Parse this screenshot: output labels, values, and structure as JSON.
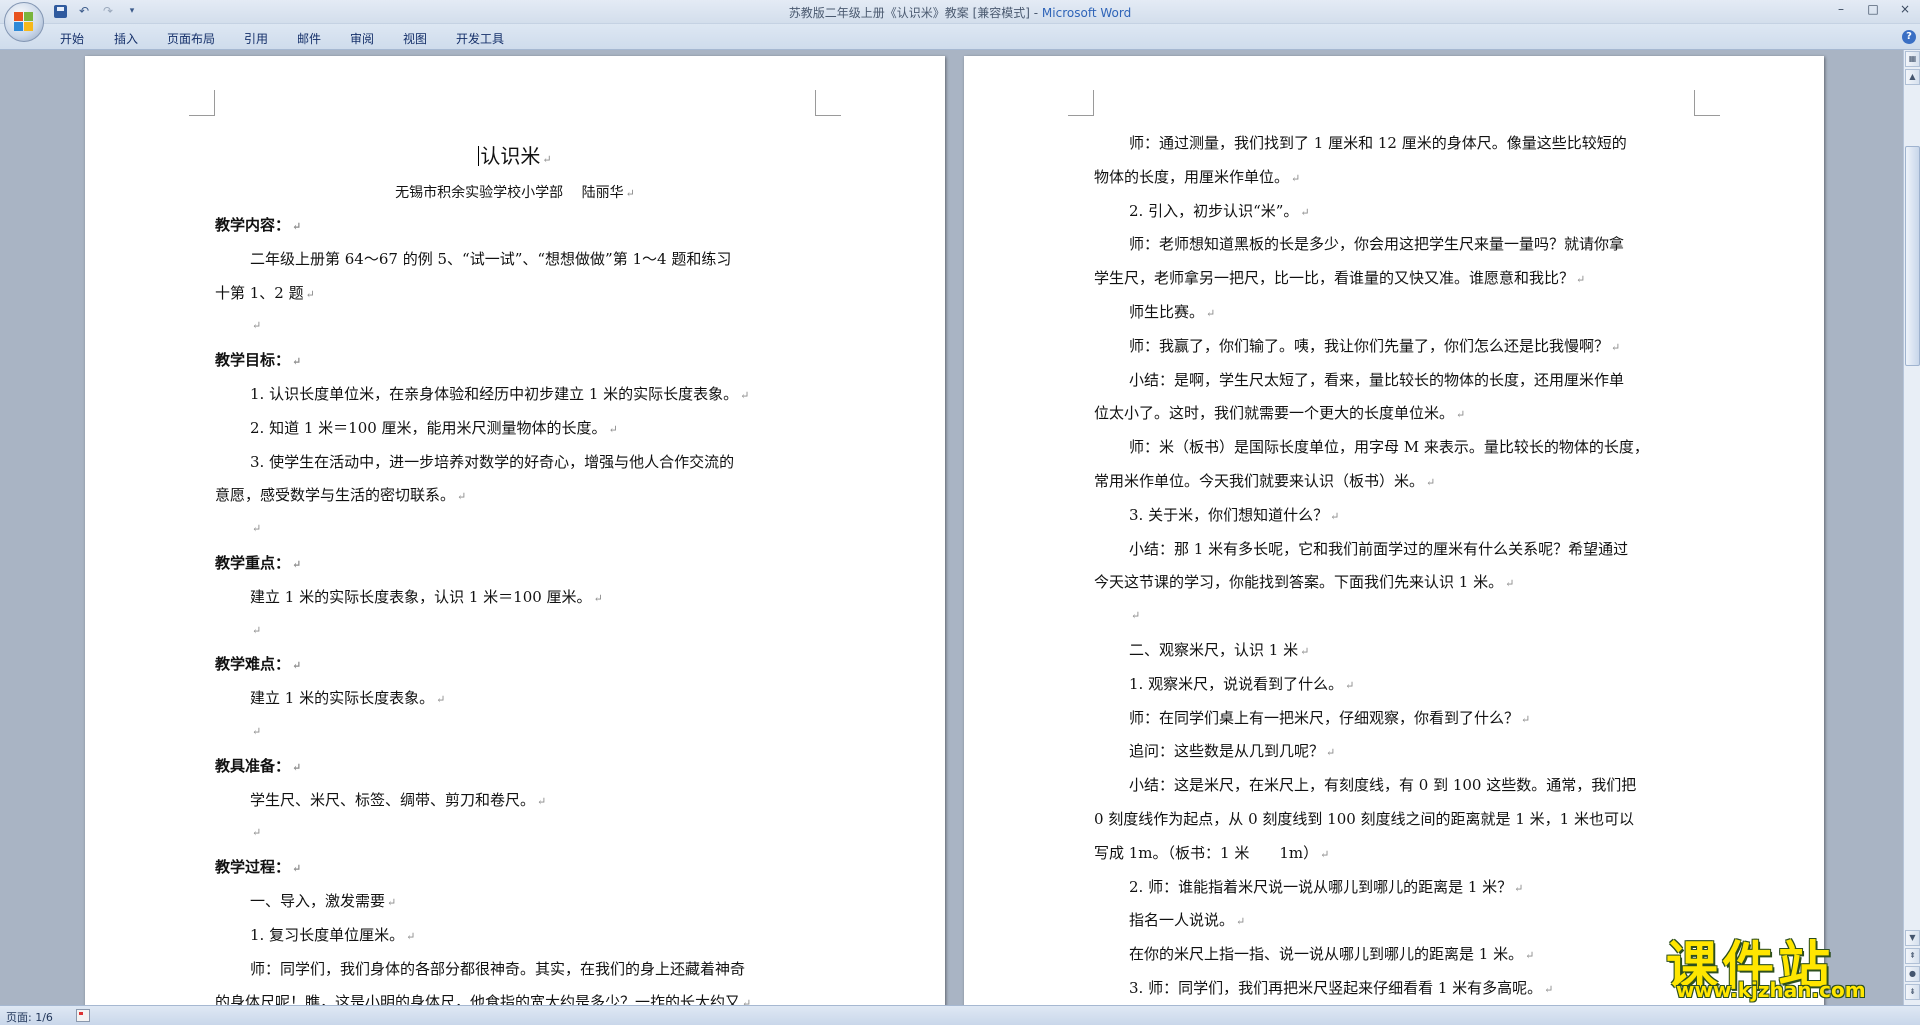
{
  "window": {
    "title_prefix": "苏教版二年级上册《认识米》教案 [兼容模式] - ",
    "title_app": "Microsoft Word",
    "controls": [
      "–",
      "□",
      "×"
    ]
  },
  "quick_access": [
    "save-icon",
    "undo-icon",
    "redo-icon",
    "customize-icon"
  ],
  "ribbon": {
    "tabs": [
      "开始",
      "插入",
      "页面布局",
      "引用",
      "邮件",
      "审阅",
      "视图",
      "开发工具"
    ]
  },
  "left_page": {
    "title": "认识米",
    "author": "无锡市积余实验学校小学部　 陆丽华",
    "lines": [
      {
        "t": "教学内容：",
        "h": true,
        "i": false
      },
      {
        "t": "二年级上册第 64～67 的例 5、“试一试”、“想想做做”第 1～4 题和练习",
        "h": false,
        "i": true
      },
      {
        "t": "十第 1、2 题",
        "h": false,
        "i": false
      },
      {
        "t": "",
        "h": false,
        "i": true
      },
      {
        "t": "教学目标：",
        "h": true,
        "i": false
      },
      {
        "t": "1. 认识长度单位米，在亲身体验和经历中初步建立 1 米的实际长度表象。",
        "h": false,
        "i": true
      },
      {
        "t": "2. 知道 1 米＝100 厘米，能用米尺测量物体的长度。",
        "h": false,
        "i": true
      },
      {
        "t": "3. 使学生在活动中，进一步培养对数学的好奇心，增强与他人合作交流的",
        "h": false,
        "i": true
      },
      {
        "t": "意愿，感受数学与生活的密切联系。",
        "h": false,
        "i": false
      },
      {
        "t": "",
        "h": false,
        "i": true
      },
      {
        "t": "教学重点：",
        "h": true,
        "i": false
      },
      {
        "t": "建立 1 米的实际长度表象，认识 1 米＝100 厘米。",
        "h": false,
        "i": true
      },
      {
        "t": "",
        "h": false,
        "i": true
      },
      {
        "t": "教学难点：",
        "h": true,
        "i": false
      },
      {
        "t": "建立 1 米的实际长度表象。",
        "h": false,
        "i": true
      },
      {
        "t": "",
        "h": false,
        "i": true
      },
      {
        "t": "教具准备：",
        "h": true,
        "i": false
      },
      {
        "t": "学生尺、米尺、标签、绸带、剪刀和卷尺。",
        "h": false,
        "i": true
      },
      {
        "t": "",
        "h": false,
        "i": true
      },
      {
        "t": "教学过程：",
        "h": true,
        "i": false
      },
      {
        "t": "一、导入，激发需要",
        "h": false,
        "i": true
      },
      {
        "t": "1. 复习长度单位厘米。",
        "h": false,
        "i": true
      },
      {
        "t": "师：同学们，我们身体的各部分都很神奇。其实，在我们的身上还藏着神奇",
        "h": false,
        "i": true
      },
      {
        "t": "的身体尺呢！瞧，这是小明的身体尺，他食指的宽大约是多少？一拃的长大约又",
        "h": false,
        "i": false
      }
    ]
  },
  "right_page": {
    "lines": [
      {
        "t": "师：通过测量，我们找到了 1 厘米和 12 厘米的身体尺。像量这些比较短的",
        "i": true
      },
      {
        "t": "物体的长度，用厘米作单位。",
        "i": false
      },
      {
        "t": "2. 引入，初步认识“米”。",
        "i": true
      },
      {
        "t": "师：老师想知道黑板的长是多少，你会用这把学生尺来量一量吗？就请你拿",
        "i": true
      },
      {
        "t": "学生尺，老师拿另一把尺，比一比，看谁量的又快又准。谁愿意和我比？",
        "i": false
      },
      {
        "t": "师生比赛。",
        "i": true
      },
      {
        "t": "师：我赢了，你们输了。咦，我让你们先量了，你们怎么还是比我慢啊？",
        "i": true
      },
      {
        "t": "小结：是啊，学生尺太短了，看来，量比较长的物体的长度，还用厘米作单",
        "i": true
      },
      {
        "t": "位太小了。这时，我们就需要一个更大的长度单位米。",
        "i": false
      },
      {
        "t": "师：米（板书）是国际长度单位，用字母 M 来表示。量比较长的物体的长度，",
        "i": true
      },
      {
        "t": "常用米作单位。今天我们就要来认识（板书）米。",
        "i": false
      },
      {
        "t": "3. 关于米，你们想知道什么？",
        "i": true
      },
      {
        "t": "小结：那 1 米有多长呢，它和我们前面学过的厘米有什么关系呢？希望通过",
        "i": true
      },
      {
        "t": "今天这节课的学习，你能找到答案。下面我们先来认识 1 米。",
        "i": false
      },
      {
        "t": "",
        "i": true
      },
      {
        "t": "二、观察米尺，认识 1 米",
        "i": true
      },
      {
        "t": "1. 观察米尺，说说看到了什么。",
        "i": true
      },
      {
        "t": "师：在同学们桌上有一把米尺，仔细观察，你看到了什么？",
        "i": true
      },
      {
        "t": "追问：这些数是从几到几呢？",
        "i": true
      },
      {
        "t": "小结：这是米尺，在米尺上，有刻度线，有 0 到 100 这些数。通常，我们把",
        "i": true
      },
      {
        "t": "0 刻度线作为起点，从 0 刻度线到 100 刻度线之间的距离就是 1 米，1 米也可以",
        "i": false
      },
      {
        "t": "写成 1m。（板书：1 米　　1m）",
        "i": false
      },
      {
        "t": "2. 师：谁能指着米尺说一说从哪儿到哪儿的距离是 1 米？",
        "i": true
      },
      {
        "t": "指名一人说说。",
        "i": true
      },
      {
        "t": "在你的米尺上指一指、说一说从哪儿到哪儿的距离是 1 米。",
        "i": true
      },
      {
        "t": "3. 师：同学们，我们再把米尺竖起来仔细看看 1 米有多高呢。",
        "i": true
      }
    ]
  },
  "status": {
    "page_label": "页面: 1/6"
  },
  "watermark": {
    "main": "课件站",
    "url": "www.kjzhan.com"
  },
  "colors": {
    "app_accent": "#2f64b8",
    "watermark": "#ffe600"
  }
}
